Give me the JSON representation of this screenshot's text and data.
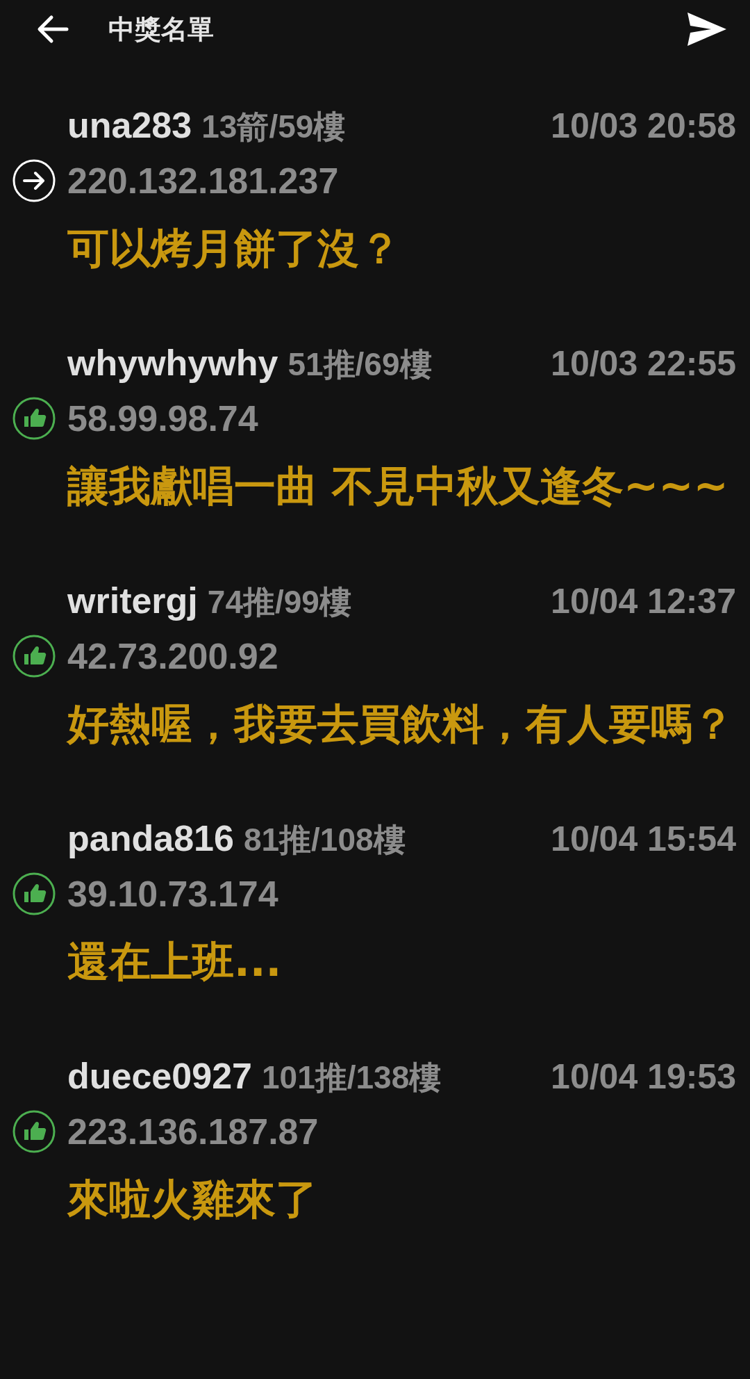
{
  "header": {
    "title": "中獎名單"
  },
  "comments": [
    {
      "kind": "arrow",
      "user": "una283",
      "stats": "13箭/59樓",
      "time": "10/03 20:58",
      "ip": "220.132.181.237",
      "text": "可以烤月餅了沒？"
    },
    {
      "kind": "like",
      "user": "whywhywhy",
      "stats": "51推/69樓",
      "time": "10/03 22:55",
      "ip": "58.99.98.74",
      "text": "讓我獻唱一曲 不見中秋又逢冬~~~"
    },
    {
      "kind": "like",
      "user": "writergj",
      "stats": "74推/99樓",
      "time": "10/04 12:37",
      "ip": "42.73.200.92",
      "text": "好熱喔，我要去買飲料，有人要嗎？"
    },
    {
      "kind": "like",
      "user": "panda816",
      "stats": "81推/108樓",
      "time": "10/04 15:54",
      "ip": "39.10.73.174",
      "text": "還在上班..."
    },
    {
      "kind": "like",
      "user": "duece0927",
      "stats": "101推/138樓",
      "time": "10/04 19:53",
      "ip": "223.136.187.87",
      "text": "來啦火雞來了"
    }
  ]
}
